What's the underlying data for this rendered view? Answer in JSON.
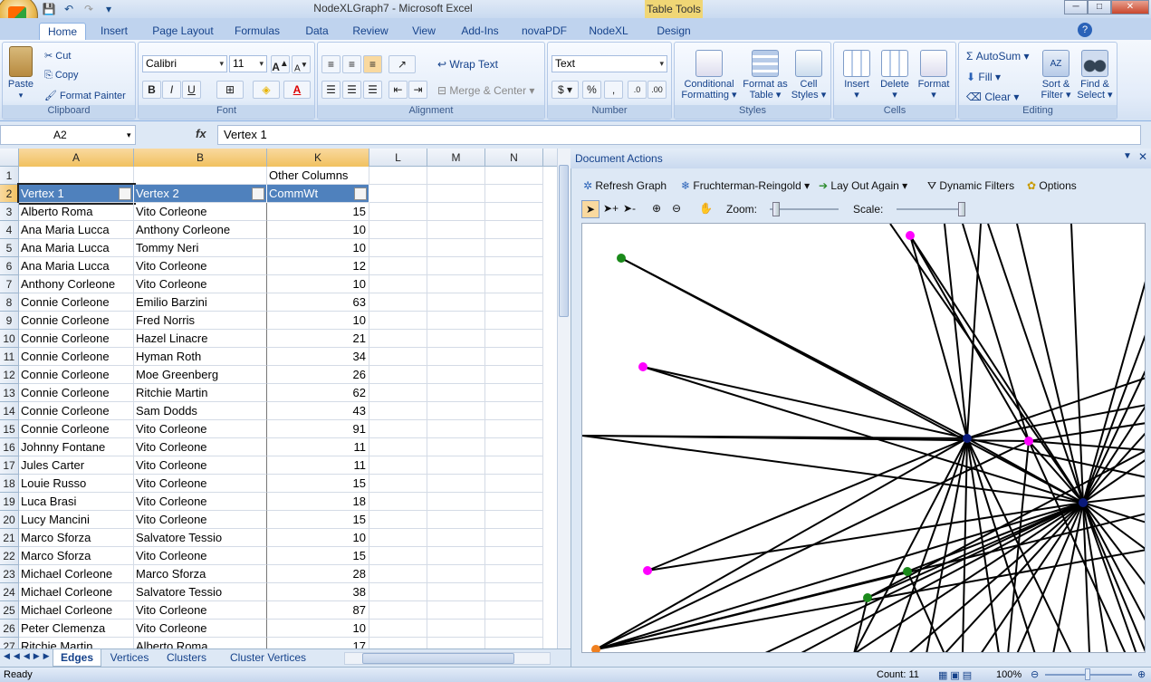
{
  "window": {
    "title": "NodeXLGraph7 - Microsoft Excel",
    "contextual_tab_group": "Table Tools"
  },
  "ribbon_tabs": [
    "Home",
    "Insert",
    "Page Layout",
    "Formulas",
    "Data",
    "Review",
    "View",
    "Add-Ins",
    "novaPDF",
    "NodeXL",
    "Design"
  ],
  "ribbon": {
    "clipboard": {
      "paste": "Paste",
      "cut": "Cut",
      "copy": "Copy",
      "format_painter": "Format Painter",
      "label": "Clipboard"
    },
    "font": {
      "name": "Calibri",
      "size": "11",
      "label": "Font"
    },
    "alignment": {
      "wrap_text": "Wrap Text",
      "merge_center": "Merge & Center",
      "label": "Alignment"
    },
    "number": {
      "format": "Text",
      "label": "Number"
    },
    "styles": {
      "conditional": "Conditional Formatting",
      "format_table": "Format as Table",
      "cell_styles": "Cell Styles",
      "label": "Styles"
    },
    "cells": {
      "insert": "Insert",
      "delete": "Delete",
      "format": "Format",
      "label": "Cells"
    },
    "editing": {
      "autosum": "AutoSum",
      "fill": "Fill",
      "clear": "Clear",
      "sort_filter": "Sort & Filter",
      "find_select": "Find & Select",
      "label": "Editing"
    }
  },
  "formula_bar": {
    "name_box": "A2",
    "formula": "Vertex 1"
  },
  "sheet": {
    "columns": [
      "A",
      "B",
      "K",
      "L",
      "M",
      "N"
    ],
    "row1_note": "Other Columns",
    "headers": [
      "Vertex 1",
      "Vertex 2",
      "CommWt"
    ],
    "row_numbers": [
      "1",
      "2",
      "3",
      "4",
      "5",
      "6",
      "7",
      "8",
      "9",
      "10",
      "11",
      "12",
      "13",
      "14",
      "15",
      "16",
      "17",
      "18",
      "19",
      "20",
      "21",
      "22",
      "23",
      "24",
      "25",
      "26",
      "27"
    ],
    "rows": [
      [
        "Alberto Roma",
        "Vito Corleone",
        "15"
      ],
      [
        "Ana Maria Lucca",
        "Anthony Corleone",
        "10"
      ],
      [
        "Ana Maria Lucca",
        "Tommy Neri",
        "10"
      ],
      [
        "Ana Maria Lucca",
        "Vito Corleone",
        "12"
      ],
      [
        "Anthony Corleone",
        "Vito Corleone",
        "10"
      ],
      [
        "Connie Corleone",
        "Emilio Barzini",
        "63"
      ],
      [
        "Connie Corleone",
        "Fred Norris",
        "10"
      ],
      [
        "Connie Corleone",
        "Hazel Linacre",
        "21"
      ],
      [
        "Connie Corleone",
        "Hyman Roth",
        "34"
      ],
      [
        "Connie Corleone",
        "Moe Greenberg",
        "26"
      ],
      [
        "Connie Corleone",
        "Ritchie Martin",
        "62"
      ],
      [
        "Connie Corleone",
        "Sam Dodds",
        "43"
      ],
      [
        "Connie Corleone",
        "Vito Corleone",
        "91"
      ],
      [
        "Johnny Fontane",
        "Vito Corleone",
        "11"
      ],
      [
        "Jules Carter",
        "Vito Corleone",
        "11"
      ],
      [
        "Louie Russo",
        "Vito Corleone",
        "15"
      ],
      [
        "Luca Brasi",
        "Vito Corleone",
        "18"
      ],
      [
        "Lucy Mancini",
        "Vito Corleone",
        "15"
      ],
      [
        "Marco Sforza",
        "Salvatore Tessio",
        "10"
      ],
      [
        "Marco Sforza",
        "Vito Corleone",
        "15"
      ],
      [
        "Michael Corleone",
        "Marco Sforza",
        "28"
      ],
      [
        "Michael Corleone",
        "Salvatore Tessio",
        "38"
      ],
      [
        "Michael Corleone",
        "Vito Corleone",
        "87"
      ],
      [
        "Peter Clemenza",
        "Vito Corleone",
        "10"
      ],
      [
        "Ritchie Martin",
        "Alberto Roma",
        "17"
      ]
    ],
    "tabs": [
      "Edges",
      "Vertices",
      "Clusters",
      "Cluster Vertices"
    ]
  },
  "document_actions": {
    "title": "Document Actions",
    "refresh": "Refresh Graph",
    "layout": "Fruchterman-Reingold",
    "lay_out_again": "Lay Out Again",
    "dynamic_filters": "Dynamic Filters",
    "options": "Options",
    "zoom_label": "Zoom:",
    "scale_label": "Scale:",
    "zoom_level": 0.05,
    "scale_level": 1.0
  },
  "graph": {
    "node_colors": {
      "green": "#1a8a1a",
      "magenta": "#ff00ff",
      "navy": "#0a1a7a",
      "orange": "#f08020"
    }
  },
  "status": {
    "ready": "Ready",
    "count": "Count: 11",
    "zoom": "100%"
  }
}
